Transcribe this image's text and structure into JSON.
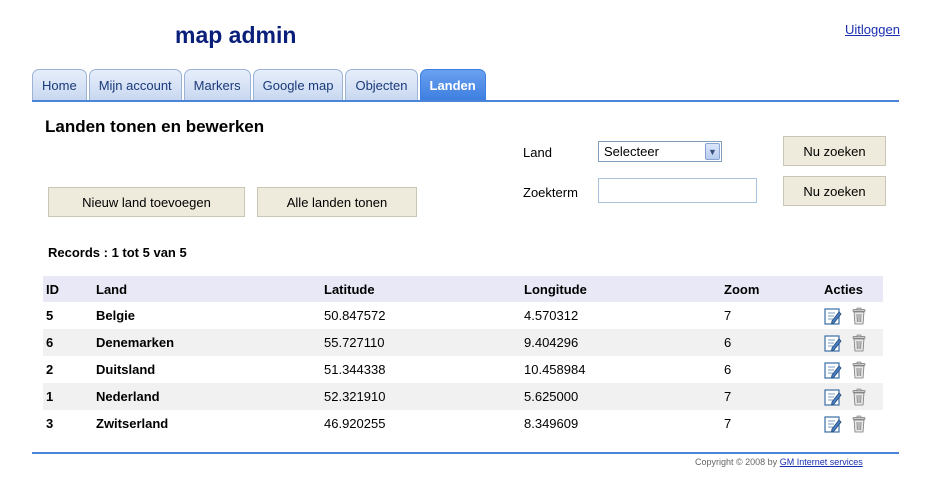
{
  "header": {
    "title": "map admin",
    "logout_label": "Uitloggen"
  },
  "tabs": [
    {
      "label": "Home"
    },
    {
      "label": "Mijn account"
    },
    {
      "label": "Markers"
    },
    {
      "label": "Google map"
    },
    {
      "label": "Objecten"
    },
    {
      "label": "Landen",
      "active": true
    }
  ],
  "section": {
    "title": "Landen tonen en bewerken"
  },
  "actions": {
    "new_label": "Nieuw land toevoegen",
    "all_label": "Alle landen tonen"
  },
  "search": {
    "land_label": "Land",
    "land_selected": "Selecteer",
    "term_label": "Zoekterm",
    "term_value": "",
    "search_label_1": "Nu zoeken",
    "search_label_2": "Nu zoeken"
  },
  "records": "Records : 1 tot 5 van 5",
  "table": {
    "headers": [
      "ID",
      "Land",
      "Latitude",
      "Longitude",
      "Zoom",
      "Acties"
    ],
    "rows": [
      [
        "5",
        "Belgie",
        "50.847572",
        "4.570312",
        "7"
      ],
      [
        "6",
        "Denemarken",
        "55.727110",
        "9.404296",
        "6"
      ],
      [
        "2",
        "Duitsland",
        "51.344338",
        "10.458984",
        "6"
      ],
      [
        "1",
        "Nederland",
        "52.321910",
        "5.625000",
        "7"
      ],
      [
        "3",
        "Zwitserland",
        "46.920255",
        "8.349609",
        "7"
      ]
    ]
  },
  "footer": {
    "copyright": "Copyright © 2008 by",
    "company": "GM Internet services"
  },
  "icons": {
    "edit": "edit-icon",
    "delete": "trash-icon"
  },
  "colors": {
    "accent": "#4a86d8",
    "title": "#0a1f7a",
    "active_tab": "#3d7fe0",
    "button": "#eeeadc"
  }
}
